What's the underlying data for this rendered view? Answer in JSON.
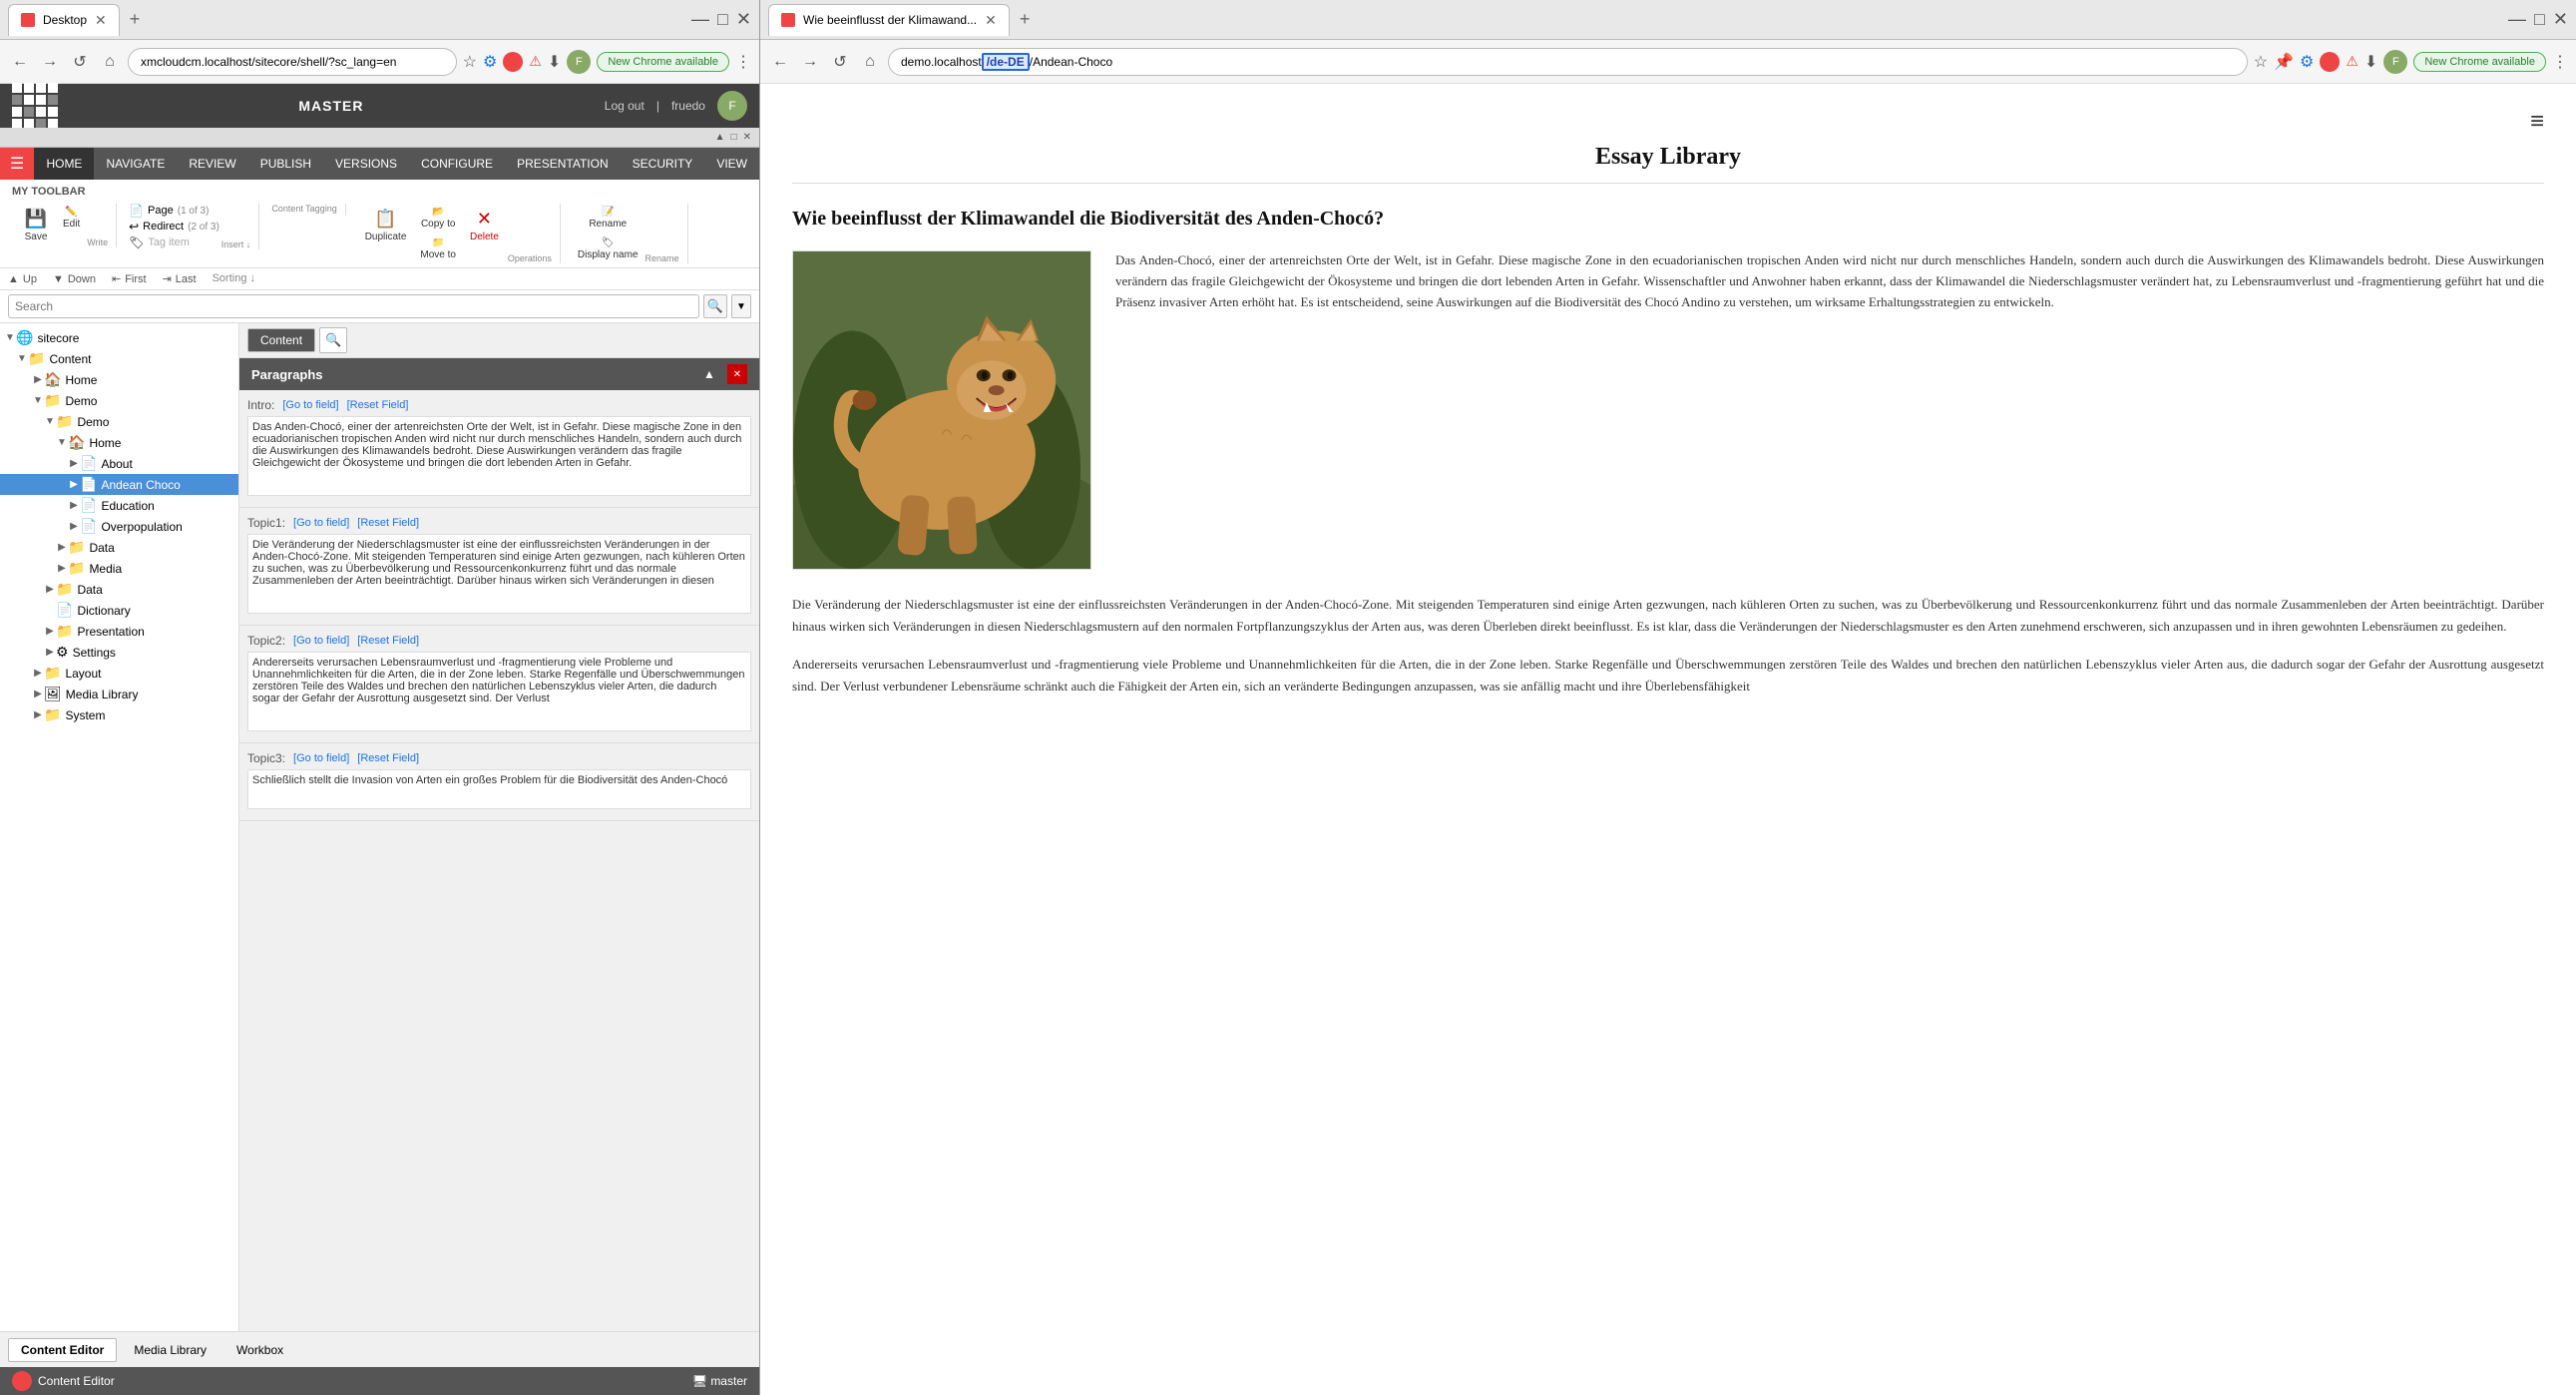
{
  "left_browser": {
    "tab_title": "Desktop",
    "tab_url": "xmcloudcm.localhost/sitecore/shell/?sc_lang=en",
    "new_chrome_label": "New Chrome available",
    "nav_buttons": [
      "←",
      "→",
      "↺",
      "⌂"
    ],
    "sitecore": {
      "master_label": "MASTER",
      "logout_label": "Log out",
      "username": "fruedo",
      "menu_items": [
        "HOME",
        "NAVIGATE",
        "REVIEW",
        "PUBLISH",
        "VERSIONS",
        "CONFIGURE",
        "PRESENTATION",
        "SECURITY",
        "VIEW"
      ],
      "my_toolbar_label": "MY TOOLBAR",
      "ribbon_groups": {
        "write": {
          "save_label": "Save",
          "edit_label": "Edit",
          "group_name": "Write"
        },
        "insert": {
          "page_label": "Page",
          "redirect_label": "Redirect",
          "tag_item_label": "Tag item",
          "count1": "(1 of 3)",
          "count2": "(2 of 3)",
          "group_name": "Insert ↓"
        },
        "content_tagging": {
          "group_name": "Content Tagging"
        },
        "operations": {
          "duplicate_label": "Duplicate",
          "copy_to_label": "Copy to",
          "move_to_label": "Move to",
          "delete_label": "Delete",
          "group_name": "Operations"
        },
        "rename": {
          "rename_label": "Rename",
          "display_name_label": "Display name",
          "group_name": "Rename"
        }
      },
      "sorting": {
        "up_label": "▲ Up",
        "down_label": "▼ Down",
        "first_label": "⇤ First",
        "last_label": "⇥ Last",
        "group_name": "Sorting ↓"
      },
      "search_placeholder": "Search",
      "content_tab_label": "Content",
      "search_tab_label": "🔍",
      "tree": {
        "items": [
          {
            "id": "sitecore",
            "label": "sitecore",
            "icon": "globe",
            "level": 0,
            "expanded": true
          },
          {
            "id": "content",
            "label": "Content",
            "icon": "folder-blue",
            "level": 1,
            "expanded": true
          },
          {
            "id": "home-top",
            "label": "Home",
            "icon": "page",
            "level": 2,
            "expanded": false
          },
          {
            "id": "demo-parent",
            "label": "Demo",
            "icon": "folder",
            "level": 2,
            "expanded": true
          },
          {
            "id": "demo-child",
            "label": "Demo",
            "icon": "folder",
            "level": 3,
            "expanded": true
          },
          {
            "id": "home-demo",
            "label": "Home",
            "icon": "page",
            "level": 4,
            "expanded": true
          },
          {
            "id": "about",
            "label": "About",
            "icon": "page",
            "level": 5,
            "expanded": false
          },
          {
            "id": "andean-choco",
            "label": "Andean Choco",
            "icon": "page-blue",
            "level": 5,
            "expanded": false,
            "selected": true
          },
          {
            "id": "education",
            "label": "Education",
            "icon": "page",
            "level": 5,
            "expanded": false
          },
          {
            "id": "overpopulation",
            "label": "Overpopulation",
            "icon": "page",
            "level": 5,
            "expanded": false
          },
          {
            "id": "data1",
            "label": "Data",
            "icon": "folder",
            "level": 4,
            "expanded": false
          },
          {
            "id": "media",
            "label": "Media",
            "icon": "folder",
            "level": 4,
            "expanded": false
          },
          {
            "id": "data2",
            "label": "Data",
            "icon": "folder",
            "level": 3,
            "expanded": false
          },
          {
            "id": "dictionary",
            "label": "Dictionary",
            "icon": "page",
            "level": 3,
            "expanded": false
          },
          {
            "id": "presentation",
            "label": "Presentation",
            "icon": "folder",
            "level": 3,
            "expanded": false
          },
          {
            "id": "settings",
            "label": "Settings",
            "icon": "gear-page",
            "level": 3,
            "expanded": false
          },
          {
            "id": "layout",
            "label": "Layout",
            "icon": "folder",
            "level": 2,
            "expanded": false
          },
          {
            "id": "media-library",
            "label": "Media Library",
            "icon": "folder-media",
            "level": 2,
            "expanded": false
          },
          {
            "id": "system",
            "label": "System",
            "icon": "folder",
            "level": 2,
            "expanded": false
          }
        ]
      },
      "paragraphs": {
        "title": "Paragraphs",
        "intro_label": "Intro:",
        "go_to_field": "[Go to field]",
        "reset_field": "[Reset Field]",
        "intro_text": "Das Anden-Chocó, einer der artenreichsten Orte der Welt, ist in Gefahr. Diese magische Zone in den ecuadorianischen tropischen Anden wird nicht nur durch menschliches Handeln, sondern auch durch die Auswirkungen des Klimawandels bedroht. Diese Auswirkungen verändern das fragile Gleichgewicht der Ökosysteme und bringen die dort lebenden Arten in Gefahr.",
        "topic1_label": "Topic1:",
        "topic1_go": "[Go to field]",
        "topic1_reset": "[Reset Field]",
        "topic1_text": "Die Veränderung der Niederschlagsmuster ist eine der einflussreichsten Veränderungen in der Anden-Chocó-Zone. Mit steigenden Temperaturen sind einige Arten gezwungen, nach kühleren Orten zu suchen, was zu Überbevölkerung und Ressourcenkonkurrenz führt und das normale Zusammenleben der Arten beeinträchtigt. Darüber hinaus wirken sich Veränderungen in diesen",
        "topic2_label": "Topic2:",
        "topic2_go": "[Go to field]",
        "topic2_reset": "[Reset Field]",
        "topic2_text": "Andererseits verursachen Lebensraumverlust und -fragmentierung viele Probleme und Unannehmlichkeiten für die Arten, die in der Zone leben. Starke Regenfälle und Überschwemmungen zerstören Teile des Waldes und brechen den natürlichen Lebenszyklus vieler Arten, die dadurch sogar der Gefahr der Ausrottung ausgesetzt sind. Der Verlust",
        "topic3_label": "Topic3:",
        "topic3_go": "[Go to field]",
        "topic3_reset": "[Reset Field]",
        "topic3_text": "Schließlich stellt die Invasion von Arten ein großes Problem für die Biodiversität des Anden-Chocó"
      }
    },
    "bottom_tabs": [
      "Content Editor",
      "Media Library",
      "Workbox"
    ],
    "active_tab": "Content Editor",
    "status_left": "Content Editor",
    "status_right": "master"
  },
  "right_browser": {
    "tab_title": "Wie beeinflusst der Klimawand...",
    "tab_url": "demo.localhost/de-DE/Andean-Choco",
    "url_segment_highlighted": "/de-DE",
    "new_chrome_label": "New Chrome available",
    "hamburger": "≡",
    "article": {
      "library_title": "Essay Library",
      "title": "Wie beeinflusst der Klimawandel die Biodiversität des Anden-Chocó?",
      "intro_paragraph": "Das Anden-Chocó, einer der artenreichsten Orte der Welt, ist in Gefahr. Diese magische Zone in den ecuadorianischen tropischen Anden wird nicht nur durch menschliches Handeln, sondern auch durch die Auswirkungen des Klimawandels bedroht. Diese Auswirkungen verändern das fragile Gleichgewicht der Ökosysteme und bringen die dort lebenden Arten in Gefahr. Wissenschaftler und Anwohner haben erkannt, dass der Klimawandel die Niederschlagsmuster verändert hat, zu Lebensraumverlust und -fragmentierung geführt hat und die Präsenz invasiver Arten erhöht hat. Es ist entscheidend, seine Auswirkungen auf die Biodiversität des Chocó Andino zu verstehen, um wirksame Erhaltungsstrategien zu entwickeln.",
      "body_paragraph1": "Die Veränderung der Niederschlagsmuster ist eine der einflussreichsten Veränderungen in der Anden-Chocó-Zone. Mit steigenden Temperaturen sind einige Arten gezwungen, nach kühleren Orten zu suchen, was zu Überbevölkerung und Ressourcenkonkurrenz führt und das normale Zusammenleben der Arten beeinträchtigt. Darüber hinaus wirken sich Veränderungen in diesen Niederschlagsmustern auf den normalen Fortpflanzungszyklus der Arten aus, was deren Überleben direkt beeinflusst. Es ist klar, dass die Veränderungen der Niederschlagsmuster es den Arten zunehmend erschweren, sich anzupassen und in ihren gewohnten Lebensräumen zu gedeihen.",
      "body_paragraph2": "Andererseits verursachen Lebensraumverlust und -fragmentierung viele Probleme und Unannehmlichkeiten für die Arten, die in der Zone leben. Starke Regenfälle und Überschwemmungen zerstören Teile des Waldes und brechen den natürlichen Lebenszyklus vieler Arten aus, die dadurch sogar der Gefahr der Ausrottung ausgesetzt sind. Der Verlust verbundener Lebensräume schränkt auch die Fähigkeit der Arten ein, sich an veränderte Bedingungen anzupassen, was sie anfällig macht und ihre Überlebensfähigkeit"
    }
  }
}
